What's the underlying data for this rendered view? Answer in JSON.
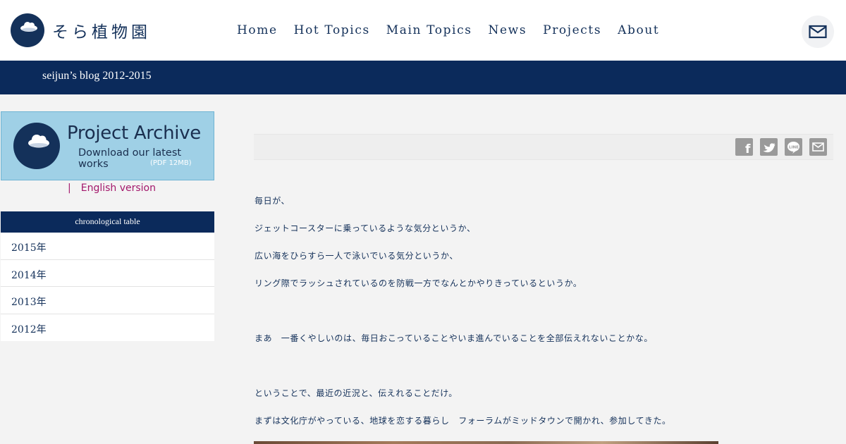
{
  "header": {
    "site_name": "そら植物園",
    "nav": [
      {
        "label": "Home"
      },
      {
        "label": "Hot Topics"
      },
      {
        "label": "Main Topics"
      },
      {
        "label": "News"
      },
      {
        "label": "Projects"
      },
      {
        "label": "About"
      }
    ],
    "mail_icon": "mail-icon"
  },
  "band": {
    "title": "seijun’s blog 2012-2015"
  },
  "sidebar": {
    "archive": {
      "title": "Project Archive",
      "subtitle": "Download our latest works",
      "size": "(PDF 12MB)"
    },
    "english_sep": "|",
    "english_link": "English version",
    "chrono_title": "chronological table",
    "years": [
      {
        "label": "2015年"
      },
      {
        "label": "2014年"
      },
      {
        "label": "2013年"
      },
      {
        "label": "2012年"
      }
    ]
  },
  "main": {
    "post_title": "",
    "share_icons": [
      "facebook-icon",
      "twitter-icon",
      "line-icon",
      "mail-icon"
    ],
    "paragraphs": [
      "毎日が、",
      "ジェットコースターに乗っているような気分というか、",
      "広い海をひらすら一人で泳いでいる気分というか、",
      "リング際でラッシュされているのを防戦一方でなんとかやりきっているというか。",
      "まあ　一番くやしいのは、毎日おこっていることやいま進んでいることを全部伝えれないことかな。",
      "ということで、最近の近況と、伝えれることだけ。",
      "まずは文化庁がやっている、地球を恋する暮らし　フォーラムがミッドタウンで開かれ、参加してきた。"
    ]
  },
  "colors": {
    "navy": "#0b2a5b",
    "text": "#14315a",
    "link": "#a3176b",
    "banner": "#9fd0e6"
  }
}
